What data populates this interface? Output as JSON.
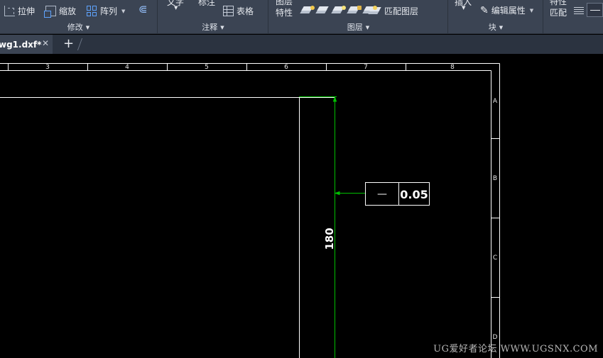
{
  "ribbon": {
    "modify": {
      "stretch_label": "拉伸",
      "stretch_icon": "stretch-icon",
      "scale_label": "缩放",
      "scale_icon": "scale-icon",
      "array_label": "阵列",
      "array_icon": "array-icon",
      "offset_icon": "offset-icon",
      "panel_title": "修改"
    },
    "annotation": {
      "text_label": "文字",
      "dimension_label": "标注",
      "table_label": "表格",
      "table_icon": "table-icon",
      "panel_title": "注释"
    },
    "layers": {
      "layer_props_line1": "图层",
      "layer_props_line2": "特性",
      "layer_icons": [
        "layer-on-icon",
        "layer-isolate-icon",
        "layer-freeze-icon",
        "layer-lock-icon",
        "layer-make-current-icon"
      ],
      "match_layer_label": "匹配图层",
      "panel_title": "图层"
    },
    "block": {
      "insert_label": "插入",
      "edit_attributes_label": "编辑属性",
      "edit_attributes_icon": "edit-attributes-icon",
      "panel_title": "块"
    },
    "properties": {
      "match_props_line1": "特性",
      "match_props_line2": "匹配"
    }
  },
  "tabs": {
    "document_tab_label": "wg1.dxf*",
    "close_symbol": "✕",
    "add_symbol": "+"
  },
  "drawing": {
    "column_labels": [
      "3",
      "4",
      "5",
      "6",
      "7",
      "8"
    ],
    "row_labels": [
      "A",
      "B",
      "C",
      "D"
    ],
    "dimension_text": "180",
    "tolerance_symbol": "—",
    "tolerance_value": "0.05",
    "colors": {
      "background": "#000000",
      "frame": "#ffffff",
      "dimension": "#00c000",
      "ribbon": "#3b4453"
    }
  },
  "watermark": "UG爱好者论坛 WWW.UGSNX.COM"
}
